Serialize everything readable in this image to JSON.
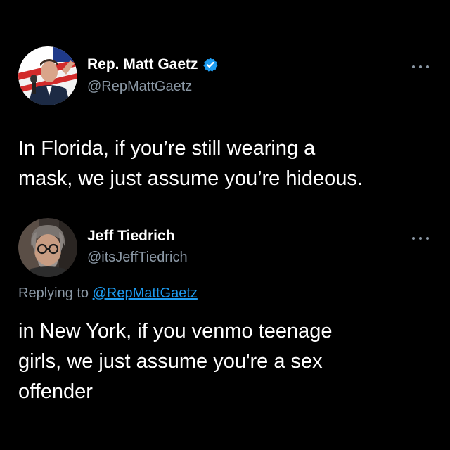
{
  "tweets": [
    {
      "author": {
        "display_name": "Rep. Matt Gaetz",
        "handle": "@RepMattGaetz",
        "verified": true
      },
      "avatar_icon": "person-speaking-photo-avatar",
      "more_icon": "more-options-icon",
      "text": "In Florida, if you’re still wearing a\nmask, we just assume you’re hideous."
    },
    {
      "author": {
        "display_name": "Jeff Tiedrich",
        "handle": "@itsJeffTiedrich",
        "verified": false
      },
      "avatar_icon": "man-with-glasses-photo-avatar",
      "more_icon": "more-options-icon",
      "replying_to_label": "Replying to",
      "replying_to_handle": "@RepMattGaetz",
      "text": "in New York, if you venmo teenage\ngirls, we just assume you're a sex\noffender"
    }
  ],
  "colors": {
    "background": "#000000",
    "primary_text": "#ffffff",
    "secondary_text": "#8b98a5",
    "link": "#1d9bf0",
    "verified_badge": "#1d9bf0"
  }
}
